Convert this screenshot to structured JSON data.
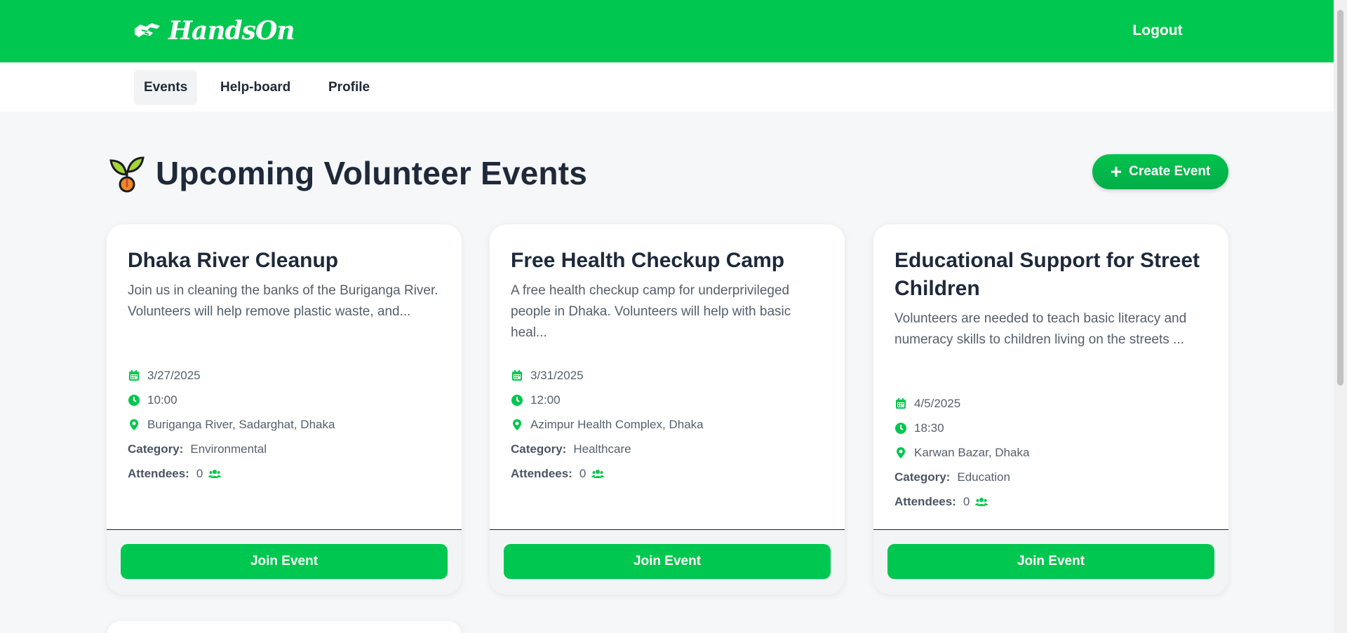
{
  "header": {
    "logo_text": "HandsOn",
    "logo_icon": "handshake-icon",
    "logout_label": "Logout",
    "brand_color": "#00c74f"
  },
  "nav": {
    "items": [
      {
        "label": "Events",
        "active": true
      },
      {
        "label": "Help-board",
        "active": false
      },
      {
        "label": "Profile",
        "active": false
      }
    ]
  },
  "main": {
    "title": "Upcoming Volunteer Events",
    "title_icon": "seedling-icon",
    "create_button_label": "Create Event",
    "create_button_icon": "plus-icon"
  },
  "labels": {
    "category": "Category:",
    "attendees": "Attendees:",
    "join": "Join Event"
  },
  "events": [
    {
      "title": "Dhaka River Cleanup",
      "description": "Join us in cleaning the banks of the Buriganga River. Volunteers will help remove plastic waste, and...",
      "date": "3/27/2025",
      "time": "10:00",
      "location": "Buriganga River, Sadarghat, Dhaka",
      "category": "Environmental",
      "attendees": "0"
    },
    {
      "title": "Free Health Checkup Camp",
      "description": "A free health checkup camp for underprivileged people in Dhaka. Volunteers will help with basic heal...",
      "date": "3/31/2025",
      "time": "12:00",
      "location": "Azimpur Health Complex, Dhaka",
      "category": "Healthcare",
      "attendees": "0"
    },
    {
      "title": "Educational Support for Street Children",
      "description": "Volunteers are needed to teach basic literacy and numeracy skills to children living on the streets ...",
      "date": "4/5/2025",
      "time": "18:30",
      "location": "Karwan Bazar, Dhaka",
      "category": "Education",
      "attendees": "0"
    }
  ]
}
